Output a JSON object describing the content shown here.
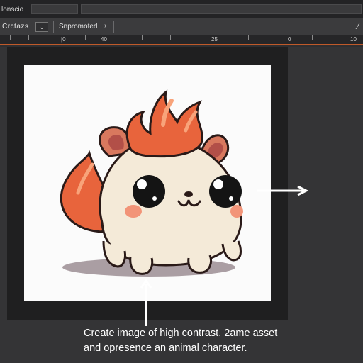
{
  "menubar": {
    "label": "lonscio"
  },
  "options": {
    "create_label": "Crctazs",
    "dropdown_icon": "chevron-down-icon",
    "preset_label": "Snpromoted",
    "chevron": "›",
    "brush_icon": "brush-icon"
  },
  "ruler": {
    "labels": [
      "|0",
      "40",
      "25",
      "0",
      "10"
    ]
  },
  "caption": {
    "line1": "Create image of high contrast, 2ame asset",
    "line2": "and opresence an animal character."
  },
  "colors": {
    "accent": "#c05a2a",
    "flame": "#e8643c",
    "body": "#f4ead8",
    "cheek": "#f29478"
  }
}
